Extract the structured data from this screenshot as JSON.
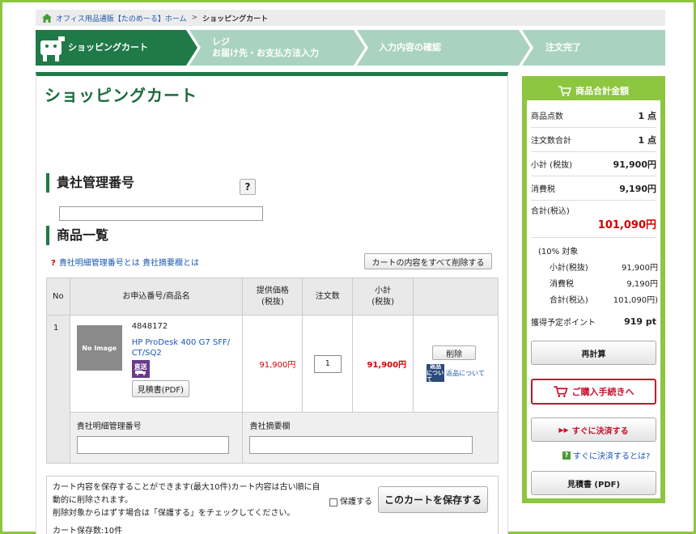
{
  "breadcrumb": {
    "home_link": "オフィス用品通販【たのめーる】ホーム",
    "separator": ">",
    "current": "ショッピングカート"
  },
  "steps": [
    {
      "label": "ショッピングカート"
    },
    {
      "label_line1": "レジ",
      "label_line2": "お届け先・お支払方法入力"
    },
    {
      "label": "入力内容の確認"
    },
    {
      "label": "注文完了"
    }
  ],
  "colors": {
    "brand_green": "#1f7a48",
    "accent_green": "#8dc63f",
    "price_red": "#d40000"
  },
  "main": {
    "title": "ショッピングカート",
    "mgmt_heading": "貴社管理番号",
    "help_button": "?",
    "mgmt_input_value": "",
    "items_heading": "商品一覧",
    "help_link_mark": "?",
    "help_link_1": "貴社明細管理番号とは",
    "help_link_2": "貴社摘要欄とは",
    "clear_button": "カートの内容をすべて削除する"
  },
  "table": {
    "headers": {
      "no": "No",
      "name": "お申込番号/商品名",
      "price_l1": "提供価格",
      "price_l2": "(税抜)",
      "qty": "注文数",
      "subtotal_l1": "小計",
      "subtotal_l2": "(税抜)"
    },
    "rows": [
      {
        "no": "1",
        "image_alt": "No Image",
        "code": "4848172",
        "name": "HP ProDesk 400 G7 SFF/CT/SQ2",
        "badge_l1": "直送",
        "pdf_button": "見積書(PDF)",
        "price": "91,900円",
        "qty": "1",
        "subtotal": "91,900円",
        "delete_button": "削除",
        "return_icon_l1": "返品",
        "return_icon_l2": "について",
        "return_link": "返品について"
      }
    ],
    "memo_label_1": "貴社明細管理番号",
    "memo_label_2": "貴社摘要欄"
  },
  "save": {
    "text_line1": "カート内容を保存することができます(最大10件)カート内容は古い順に自",
    "text_line2": "動的に削除されます。",
    "text_line3": "削除対象からはずす場合は「保護する」をチェックしてください。",
    "protect_label": "保護する",
    "save_button": "このカートを保存する",
    "count_text": "カート保存数:10件"
  },
  "side": {
    "heading": "商品合計金額",
    "item_count_label": "商品点数",
    "item_count_value": "1 点",
    "order_count_label": "注文数合計",
    "order_count_value": "1 点",
    "subtotal_label": "小計 (税抜)",
    "subtotal_value": "91,900円",
    "tax_label": "消費税",
    "tax_value": "9,190円",
    "total_label": "合計(税込)",
    "total_value": "101,090円",
    "rate_label": "(10% 対象",
    "rate_subtotal_label": "小計(税抜)",
    "rate_subtotal_value": "91,900円",
    "rate_tax_label": "消費税",
    "rate_tax_value": "9,190円",
    "rate_total_label": "合計(税込)",
    "rate_total_value": "101,090円)",
    "points_label": "獲得予定ポイント",
    "points_value": "919 pt",
    "recalc_button": "再計算",
    "buy_button": "ご購入手続きへ",
    "quick_button": "すぐに決済する",
    "quick_help_mark": "?",
    "quick_link": "すぐに決済するとは?",
    "pdf_button": "見積書 (PDF)"
  }
}
